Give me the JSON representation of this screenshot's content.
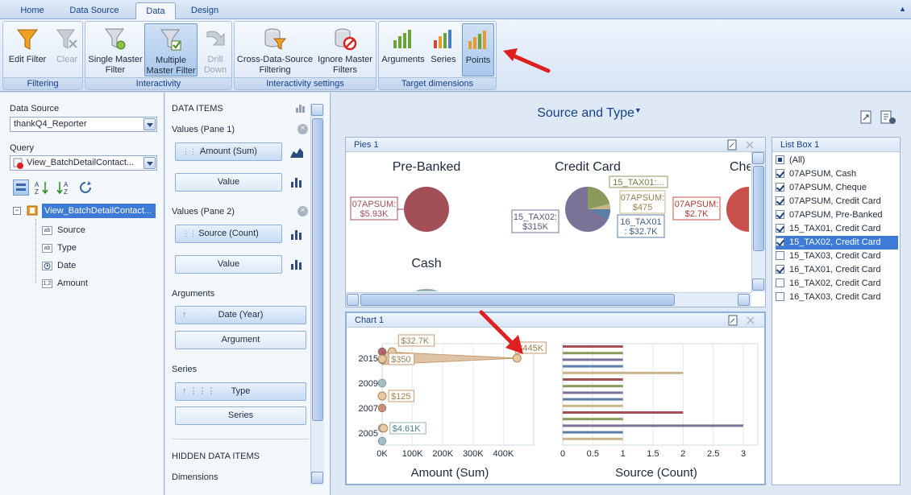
{
  "tabs": [
    "Home",
    "Data Source",
    "Data",
    "Design"
  ],
  "ribbon": {
    "groups": {
      "filtering": "Filtering",
      "interactivity": "Interactivity",
      "interactivity_settings": "Interactivity settings",
      "target_dimensions": "Target dimensions"
    },
    "buttons": {
      "edit_filter": "Edit Filter",
      "clear": "Clear",
      "single_master_1": "Single Master",
      "single_master_2": "Filter",
      "multiple_master_1": "Multiple",
      "multiple_master_2": "Master Filter",
      "drill_down_1": "Drill",
      "drill_down_2": "Down",
      "cross_ds_1": "Cross-Data-Source",
      "cross_ds_2": "Filtering",
      "ignore_master_1": "Ignore Master",
      "ignore_master_2": "Filters",
      "arguments": "Arguments",
      "series": "Series",
      "points": "Points"
    }
  },
  "left": {
    "data_source_label": "Data Source",
    "data_source_value": "thankQ4_Reporter",
    "query_label": "Query",
    "query_value": "View_BatchDetailContact...",
    "tree_root": "View_BatchDetailContact...",
    "fields": [
      {
        "name": "Source",
        "type": "ab"
      },
      {
        "name": "Type",
        "type": "ab"
      },
      {
        "name": "Date",
        "type": "clock"
      },
      {
        "name": "Amount",
        "type": "1,2"
      }
    ]
  },
  "mid": {
    "data_items": "DATA ITEMS",
    "values_pane1": "Values (Pane 1)",
    "amount_sum": "Amount (Sum)",
    "value1": "Value",
    "values_pane2": "Values (Pane 2)",
    "source_count": "Source (Count)",
    "value2": "Value",
    "arguments": "Arguments",
    "date_year": "Date (Year)",
    "argument": "Argument",
    "series": "Series",
    "type": "Type",
    "series_btn": "Series",
    "hidden": "HIDDEN DATA ITEMS",
    "dimensions": "Dimensions"
  },
  "dashboard": {
    "title": "Source and Type",
    "pies_title": "Pies 1",
    "chart_title": "Chart 1",
    "listbox_title": "List Box 1",
    "pies": [
      {
        "name": "Pre-Banked",
        "label": [
          "07APSUM:",
          "$5.93K"
        ]
      },
      {
        "name": "Credit Card",
        "labels": [
          [
            "15_TAX01:..."
          ],
          [
            "07APSUM:",
            "$475"
          ],
          [
            "15_TAX02:",
            "$315K"
          ],
          [
            "16_TAX01",
            ": $32.7K"
          ]
        ]
      },
      {
        "name": "Che",
        "label": [
          "07APSUM:",
          "$2.7K"
        ]
      },
      {
        "name": "Cash"
      }
    ],
    "listbox": [
      {
        "label": "(All)",
        "state": "part"
      },
      {
        "label": "07APSUM, Cash",
        "state": "on"
      },
      {
        "label": "07APSUM, Cheque",
        "state": "on"
      },
      {
        "label": "07APSUM, Credit Card",
        "state": "on"
      },
      {
        "label": "07APSUM, Pre-Banked",
        "state": "on"
      },
      {
        "label": "15_TAX01, Credit Card",
        "state": "on"
      },
      {
        "label": "15_TAX02, Credit Card",
        "state": "on",
        "selected": true
      },
      {
        "label": "15_TAX03, Credit Card",
        "state": "off"
      },
      {
        "label": "16_TAX01, Credit Card",
        "state": "on"
      },
      {
        "label": "16_TAX02, Credit Card",
        "state": "off"
      },
      {
        "label": "16_TAX03, Credit Card",
        "state": "off"
      }
    ]
  },
  "colors": {
    "pie_red": "#a24f58",
    "pie_olive": "#8a9a5b",
    "pie_purple": "#7a7397",
    "tan": "#d9b896",
    "teal": "#8fb4ba",
    "arrow": "#e02020"
  },
  "chart_data": [
    {
      "type": "area",
      "xlabel": "Amount (Sum)",
      "categories": [
        "2005",
        "2007",
        "2009",
        "2015"
      ],
      "xlim": [
        0,
        500000
      ],
      "x_ticks": [
        "0K",
        "100K",
        "200K",
        "300K",
        "400K"
      ],
      "points": [
        {
          "year": "2015",
          "value": 445000,
          "label": "$445K"
        },
        {
          "year": "2015",
          "value": 32700,
          "label": "$32.7K"
        },
        {
          "year": "2015",
          "value": 350,
          "label": "$350"
        },
        {
          "year": "2007",
          "value": 125,
          "label": "$125"
        },
        {
          "year": "2005",
          "value": 4610,
          "label": "$4.61K"
        }
      ]
    },
    {
      "type": "bar",
      "xlabel": "Source (Count)",
      "xlim": [
        0,
        3
      ],
      "x_ticks": [
        "0",
        "0.5",
        "1",
        "1.5",
        "2",
        "2.5",
        "3"
      ],
      "values": [
        1,
        1,
        1,
        1,
        2,
        1,
        1,
        1,
        1,
        1,
        2,
        1,
        3,
        1,
        1
      ]
    }
  ]
}
